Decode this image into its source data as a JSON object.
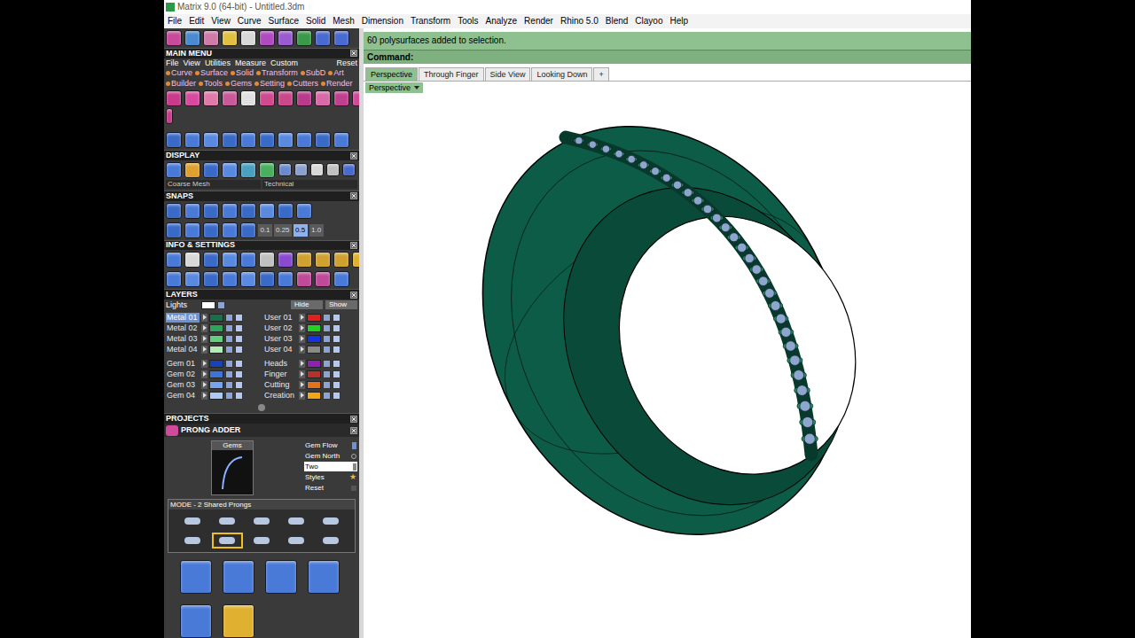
{
  "window": {
    "title": "Matrix 9.0 (64-bit) - Untitled.3dm"
  },
  "menu_bar": [
    "File",
    "Edit",
    "View",
    "Curve",
    "Surface",
    "Solid",
    "Mesh",
    "Dimension",
    "Transform",
    "Tools",
    "Analyze",
    "Render",
    "Rhino 5.0",
    "Blend",
    "Clayoo",
    "Help"
  ],
  "main_menu": {
    "title": "MAIN MENU",
    "top_items": [
      "File",
      "View",
      "Utilities",
      "Measure",
      "Custom"
    ],
    "reset": "Reset",
    "rows": [
      [
        "Curve",
        "Surface",
        "Solid",
        "Transform",
        "SubD",
        "Art"
      ],
      [
        "Builder",
        "Tools",
        "Gems",
        "Setting",
        "Cutters",
        "Render"
      ]
    ]
  },
  "display": {
    "title": "DISPLAY",
    "mesh": "Coarse Mesh",
    "mode": "Technical"
  },
  "snaps": {
    "title": "SNAPS",
    "steps": [
      {
        "label": "0.1",
        "selected": false
      },
      {
        "label": "0.25",
        "selected": false
      },
      {
        "label": "0.5",
        "selected": true
      },
      {
        "label": "1.0",
        "selected": false
      }
    ]
  },
  "info_settings": {
    "title": "INFO & SETTINGS"
  },
  "layers": {
    "title": "LAYERS",
    "lights": {
      "name": "Lights",
      "color": "#ffffff"
    },
    "hide": "Hide",
    "show": "Show",
    "blocks": [
      {
        "left": [
          {
            "name": "Metal 01",
            "color": "#17704a",
            "selected": true
          },
          {
            "name": "Metal 02",
            "color": "#2ea35a",
            "selected": false
          },
          {
            "name": "Metal 03",
            "color": "#62cf7c",
            "selected": false
          },
          {
            "name": "Metal 04",
            "color": "#b2ecb4",
            "selected": false
          }
        ],
        "right": [
          {
            "name": "User 01",
            "color": "#e0201c",
            "selected": false
          },
          {
            "name": "User 02",
            "color": "#22d022",
            "selected": false
          },
          {
            "name": "User 03",
            "color": "#1434e0",
            "selected": false
          },
          {
            "name": "User 04",
            "color": "#8a8a8a",
            "selected": false
          }
        ]
      },
      {
        "left": [
          {
            "name": "Gem 01",
            "color": "#1644b8",
            "selected": false
          },
          {
            "name": "Gem 02",
            "color": "#3c74dc",
            "selected": false
          },
          {
            "name": "Gem 03",
            "color": "#76a4ee",
            "selected": false
          },
          {
            "name": "Gem 04",
            "color": "#a8ccf6",
            "selected": false
          }
        ],
        "right": [
          {
            "name": "Heads",
            "color": "#8e22b0",
            "selected": false
          },
          {
            "name": "Finger",
            "color": "#b8302c",
            "selected": false
          },
          {
            "name": "Cutting",
            "color": "#e0741c",
            "selected": false
          },
          {
            "name": "Creation",
            "color": "#f2a614",
            "selected": false
          }
        ]
      }
    ]
  },
  "projects": {
    "title": "PROJECTS"
  },
  "prong_adder": {
    "title": "PRONG ADDER",
    "preview_label": "Gems",
    "options": [
      {
        "label": "Gem Flow",
        "kind": "toggle",
        "mark": ""
      },
      {
        "label": "Gem North",
        "kind": "radio",
        "mark": ""
      },
      {
        "label": "Two",
        "kind": "field",
        "mark": ""
      },
      {
        "label": "Styles",
        "kind": "star",
        "mark": "★"
      },
      {
        "label": "Reset",
        "kind": "button",
        "mark": ""
      }
    ],
    "mode_label": "MODE - 2 Shared Prongs",
    "modes": [
      {
        "selected": false
      },
      {
        "selected": false
      },
      {
        "selected": false
      },
      {
        "selected": false
      },
      {
        "selected": false
      },
      {
        "selected": false
      },
      {
        "selected": true
      },
      {
        "selected": false
      },
      {
        "selected": false
      },
      {
        "selected": false
      }
    ]
  },
  "command": {
    "history": "60 polysurfaces added to selection.",
    "prompt": "Command:"
  },
  "viewport_tabs": [
    {
      "label": "Perspective",
      "selected": true
    },
    {
      "label": "Through Finger",
      "selected": false
    },
    {
      "label": "Side View",
      "selected": false
    },
    {
      "label": "Looking Down",
      "selected": false
    },
    {
      "label": "+",
      "selected": false
    }
  ],
  "viewport": {
    "label": "Perspective"
  }
}
